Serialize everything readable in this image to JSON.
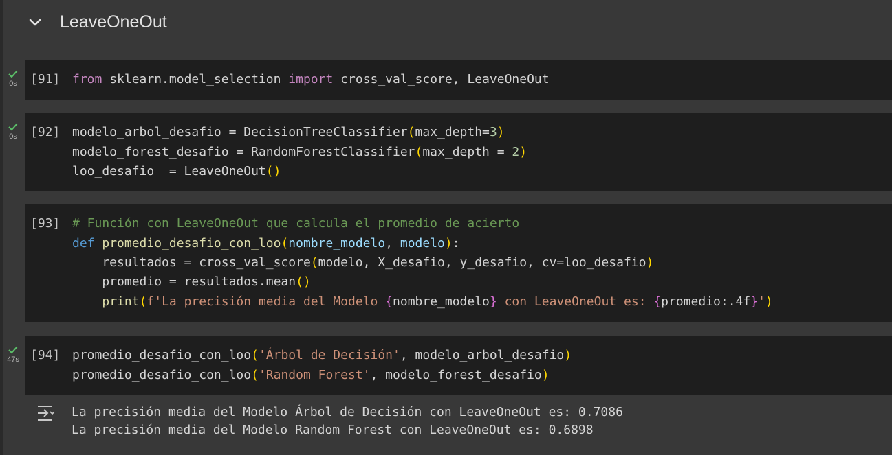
{
  "section": {
    "title": "LeaveOneOut"
  },
  "cells": [
    {
      "exec_count": "[91]",
      "time": "0s",
      "code": {
        "l1": {
          "t1": "from",
          "t2": " sklearn.model_selection ",
          "t3": "import",
          "t4": " cross_val_score, LeaveOneOut"
        }
      }
    },
    {
      "exec_count": "[92]",
      "time": "0s",
      "code": {
        "l1": {
          "t1": "modelo_arbol_desafio = DecisionTreeClassifier",
          "t2": "(",
          "t3": "max_depth=",
          "t4": "3",
          "t5": ")"
        },
        "l2": {
          "t1": "modelo_forest_desafio = RandomForestClassifier",
          "t2": "(",
          "t3": "max_depth = ",
          "t4": "2",
          "t5": ")"
        },
        "l3": {
          "t1": "loo_desafio  = LeaveOneOut",
          "t2": "()"
        }
      }
    },
    {
      "exec_count": "[93]",
      "code": {
        "l1": "# Función con LeaveOneOut que calcula el promedio de acierto",
        "l2": {
          "t1": "def",
          "t2": " ",
          "t3": "promedio_desafio_con_loo",
          "t4": "(",
          "t5": "nombre_modelo",
          "t6": ", ",
          "t7": "modelo",
          "t8": ")",
          "t9": ":"
        },
        "l3": {
          "t1": "    resultados = cross_val_score",
          "t2": "(",
          "t3": "modelo, X_desafio, y_desafio, cv=loo_desafio",
          "t4": ")"
        },
        "l4": {
          "t1": "    promedio = resultados.mean",
          "t2": "()"
        },
        "l5": {
          "t1": "    ",
          "t2": "print",
          "t3": "(",
          "t4": "f'La precisión media del Modelo ",
          "t5": "{",
          "t6": "nombre_modelo",
          "t7": "}",
          "t8": " con LeaveOneOut es: ",
          "t9": "{",
          "t10": "promedio:.4f",
          "t11": "}",
          "t12": "'",
          "t13": ")"
        }
      }
    },
    {
      "exec_count": "[94]",
      "time": "47s",
      "code": {
        "l1": {
          "t1": "promedio_desafio_con_loo",
          "t2": "(",
          "t3": "'Árbol de Decisión'",
          "t4": ", modelo_arbol_desafio",
          "t5": ")"
        },
        "l2": {
          "t1": "promedio_desafio_con_loo",
          "t2": "(",
          "t3": "'Random Forest'",
          "t4": ", modelo_forest_desafio",
          "t5": ")"
        }
      },
      "output": [
        "La precisión media del Modelo Árbol de Decisión con LeaveOneOut es: 0.7086",
        "La precisión media del Modelo Random Forest con LeaveOneOut es: 0.6898"
      ]
    }
  ],
  "colors": {
    "success": "#5cc16a",
    "cell_bg": "#1e1e1e",
    "page_bg": "#383838"
  },
  "icons": {
    "collapse": "chevron-down-icon",
    "status": "check-icon",
    "output": "output-toggle-icon"
  }
}
